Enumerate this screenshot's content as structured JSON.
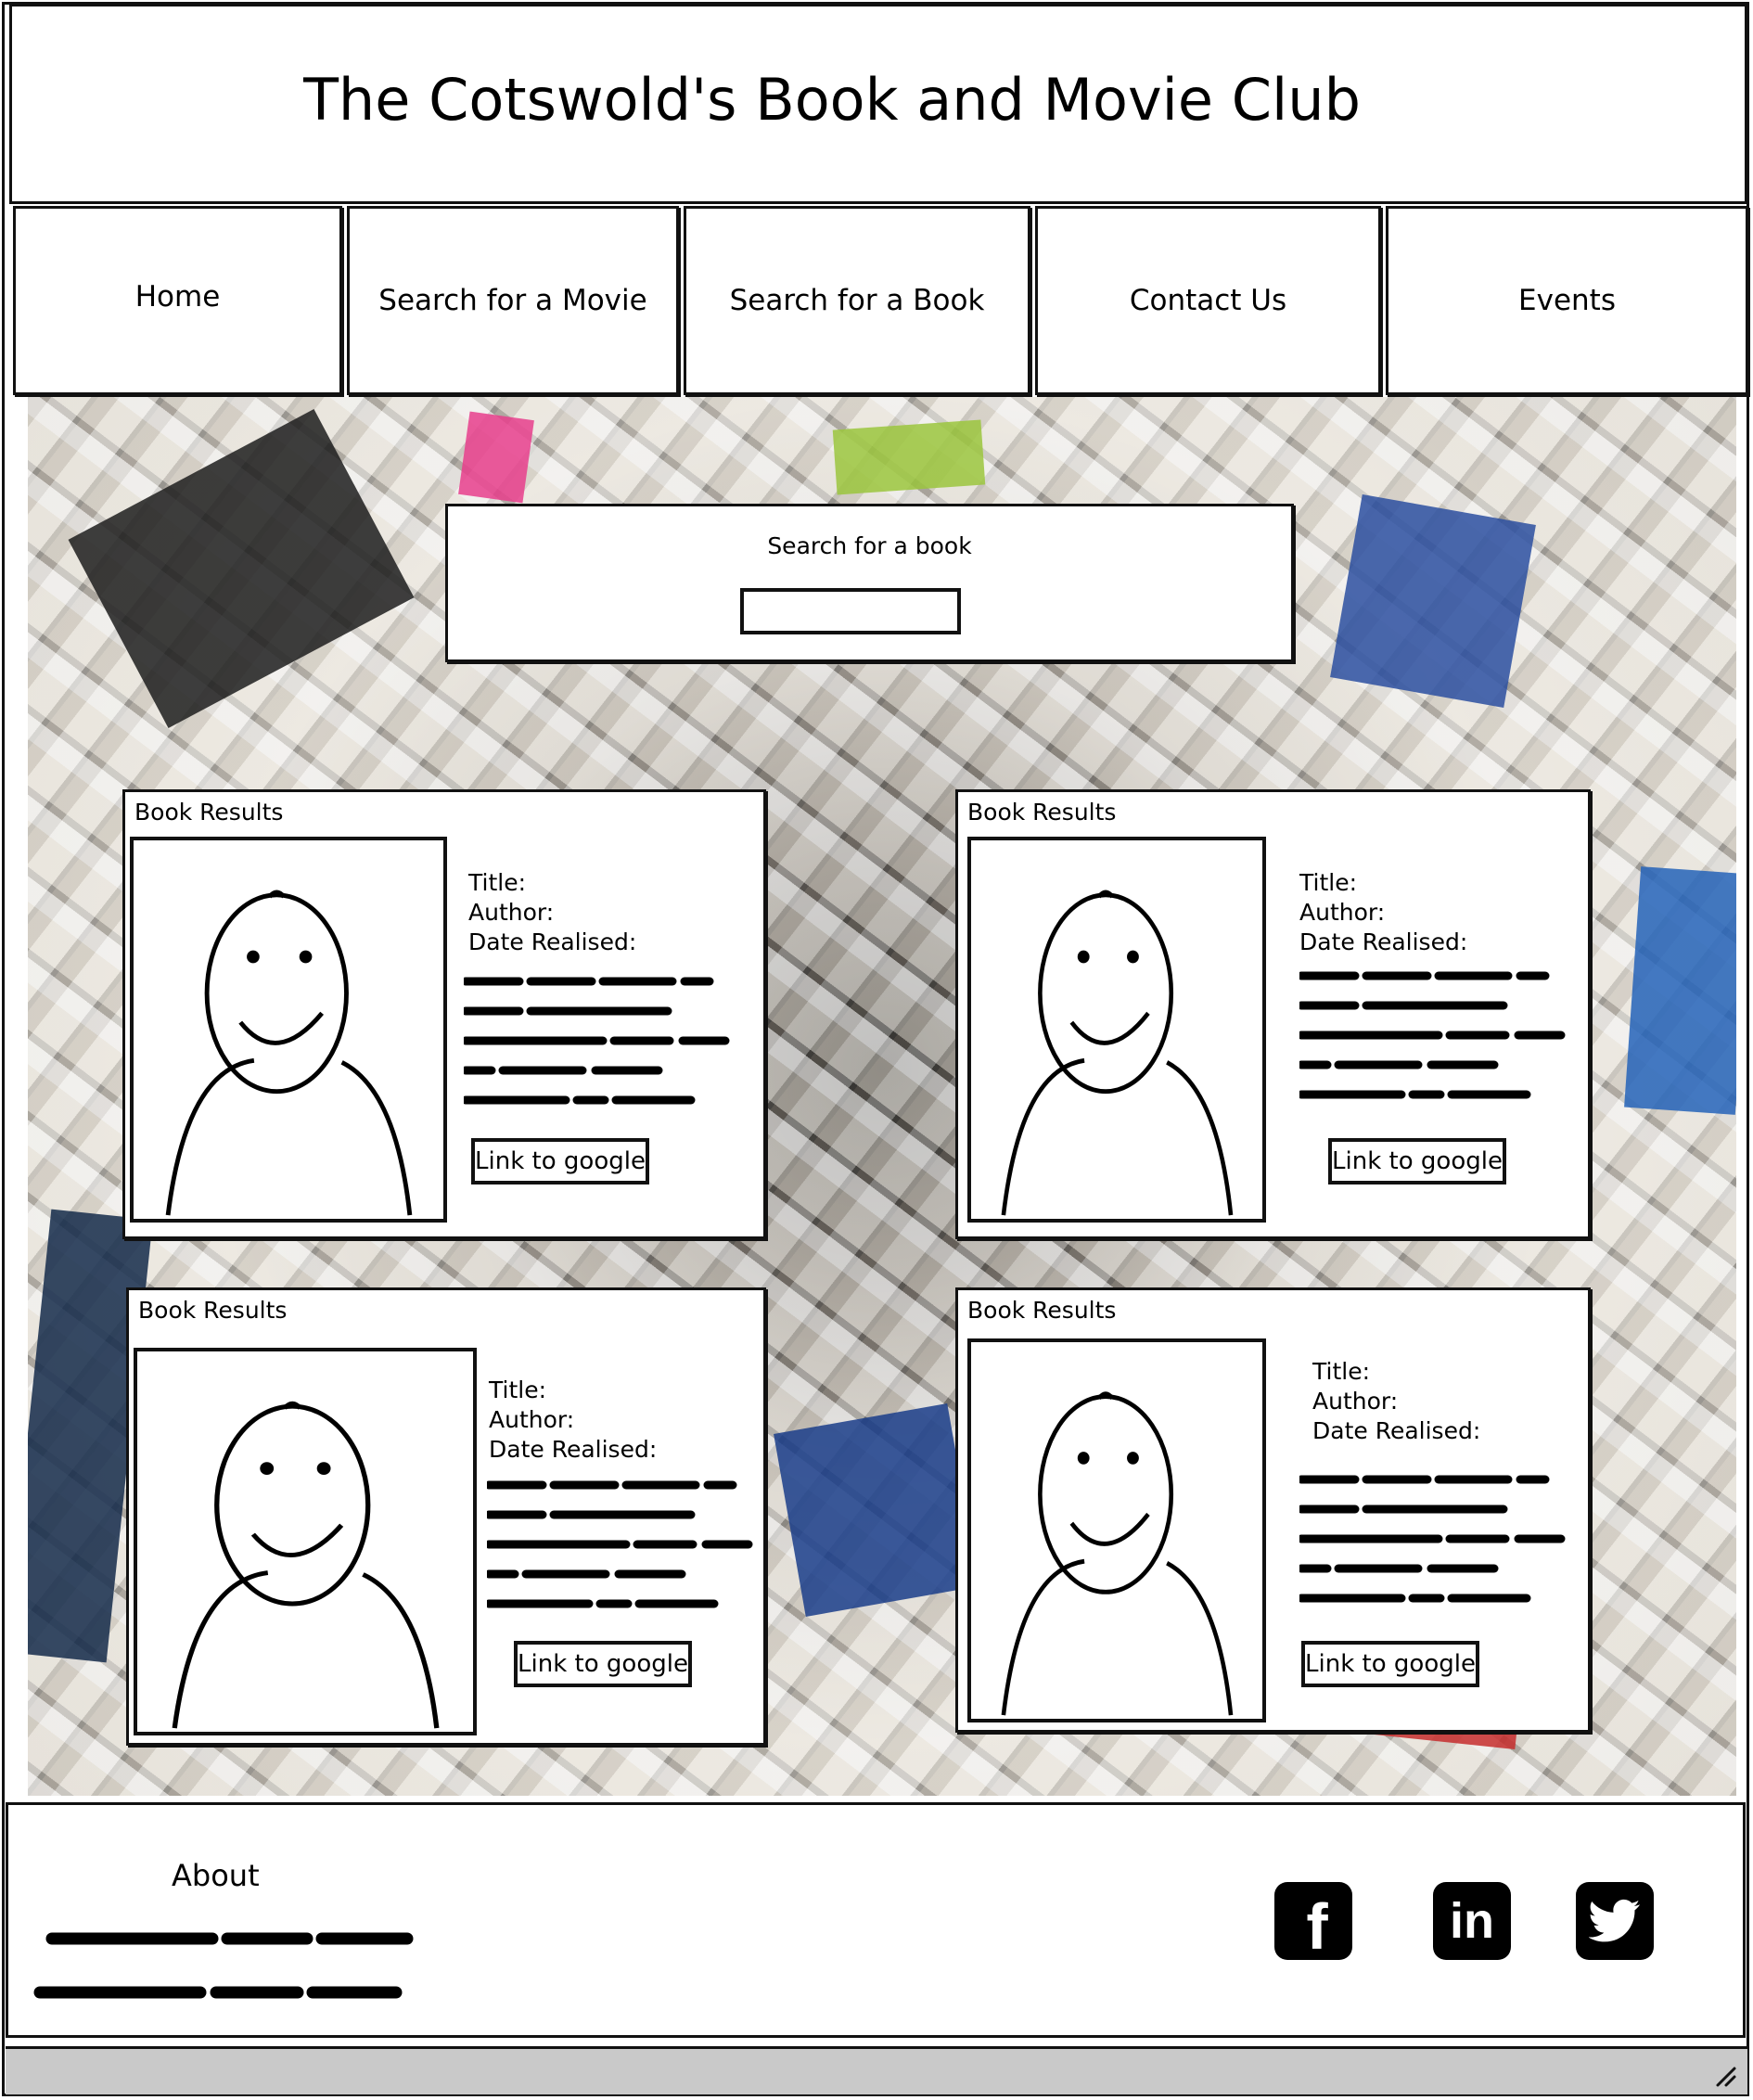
{
  "header": {
    "title": "The Cotswold's  Book and Movie Club"
  },
  "nav": {
    "items": [
      {
        "label": "Home"
      },
      {
        "label": "Search for a Movie"
      },
      {
        "label": "Search for a Book"
      },
      {
        "label": "Contact Us"
      },
      {
        "label": "Events"
      }
    ]
  },
  "search": {
    "label": "Search for a book",
    "value": ""
  },
  "results": [
    {
      "heading": "Book Results",
      "title_label": "Title:",
      "author_label": "Author:",
      "date_label": "Date Realised:",
      "link_label": "Link to google",
      "avatar_icon": "avatar-placeholder-icon"
    },
    {
      "heading": "Book Results",
      "title_label": "Title:",
      "author_label": "Author:",
      "date_label": "Date Realised:",
      "link_label": "Link to google",
      "avatar_icon": "avatar-placeholder-icon"
    },
    {
      "heading": "Book Results",
      "title_label": "Title:",
      "author_label": "Author:",
      "date_label": "Date Realised:",
      "link_label": "Link to google",
      "avatar_icon": "avatar-placeholder-icon"
    },
    {
      "heading": "Book Results",
      "title_label": "Title:",
      "author_label": "Author:",
      "date_label": "Date Realised:",
      "link_label": "Link to google",
      "avatar_icon": "avatar-placeholder-icon"
    }
  ],
  "footer": {
    "about_title": "About",
    "social": [
      {
        "icon": "facebook-icon",
        "glyph": "f"
      },
      {
        "icon": "linkedin-icon",
        "glyph": "in"
      },
      {
        "icon": "twitter-icon",
        "glyph": ""
      }
    ]
  }
}
